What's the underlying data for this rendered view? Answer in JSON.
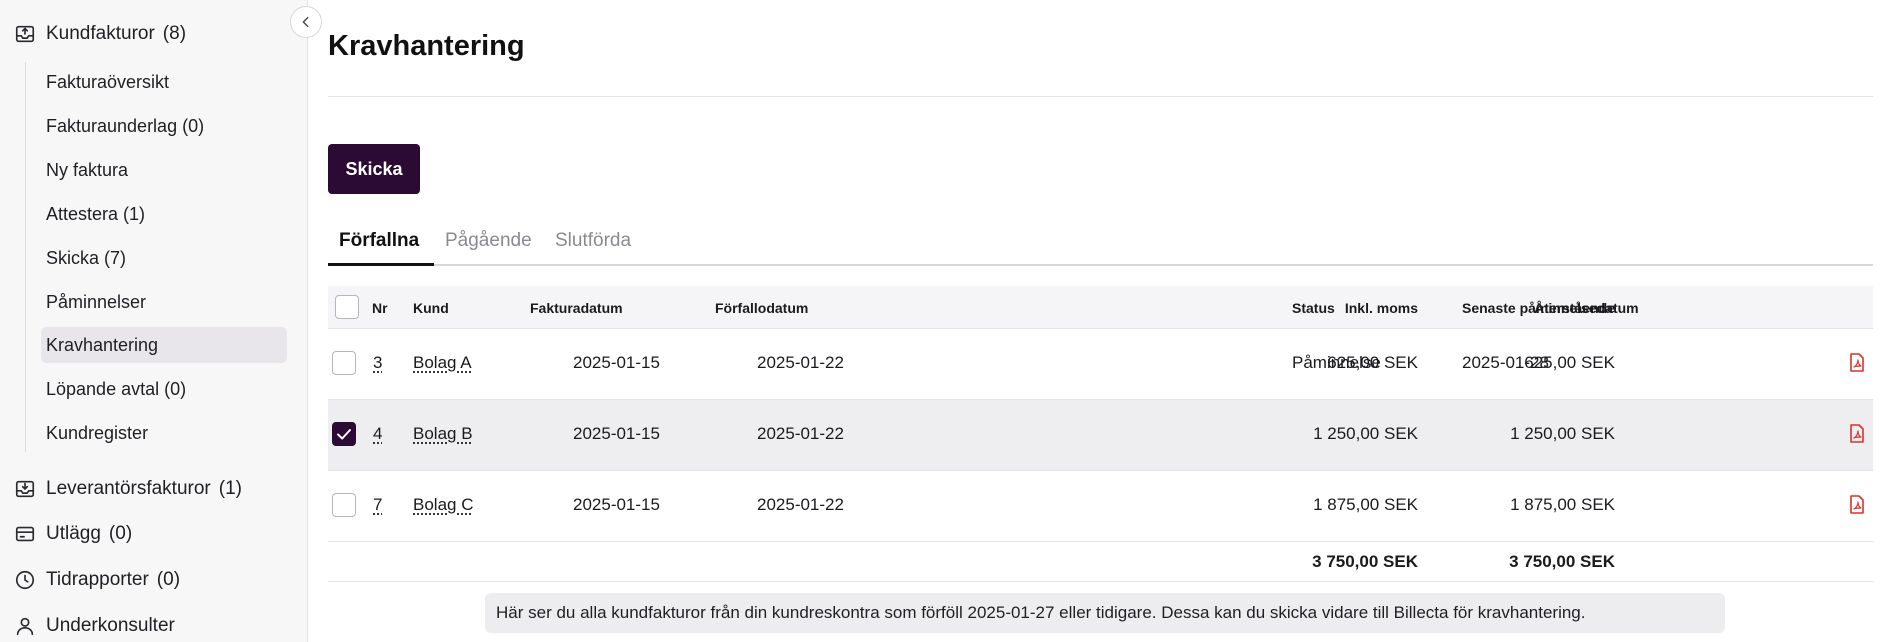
{
  "sidebar": {
    "groups": [
      {
        "label": "Kundfakturor",
        "count": "(8)",
        "icon": "invoice-out-icon"
      },
      {
        "label": "Leverantörsfakturor",
        "count": "(1)",
        "icon": "invoice-in-icon"
      },
      {
        "label": "Utlägg",
        "count": "(0)",
        "icon": "card-icon"
      },
      {
        "label": "Tidrapporter",
        "count": "(0)",
        "icon": "clock-icon"
      },
      {
        "label": "Underkonsulter",
        "count": "",
        "icon": "user-icon"
      }
    ],
    "items": [
      {
        "label": "Fakturaöversikt"
      },
      {
        "label": "Fakturaunderlag (0)"
      },
      {
        "label": "Ny faktura"
      },
      {
        "label": "Attestera (1)"
      },
      {
        "label": "Skicka (7)"
      },
      {
        "label": "Påminnelser"
      },
      {
        "label": "Kravhantering",
        "active": true
      },
      {
        "label": "Löpande avtal (0)"
      },
      {
        "label": "Kundregister"
      }
    ]
  },
  "page": {
    "title": "Kravhantering",
    "send_label": "Skicka",
    "tabs": [
      {
        "label": "Förfallna",
        "active": true
      },
      {
        "label": "Pågående"
      },
      {
        "label": "Slutförda"
      }
    ]
  },
  "table": {
    "headers": {
      "nr": "Nr",
      "kund": "Kund",
      "fakturadatum": "Fakturadatum",
      "forfallodatum": "Förfallodatum",
      "inkl_moms": "Inkl. moms",
      "aterstaende": "Återstående",
      "status": "Status",
      "senaste": "Senaste påminnelsedatum"
    },
    "rows": [
      {
        "nr": "3",
        "kund": "Bolag A",
        "fakturadatum": "2025-01-15",
        "forfallodatum": "2025-01-22",
        "inkl_moms": "625,00 SEK",
        "aterstaende": "625,00 SEK",
        "status": "Påminnelse",
        "senaste": "2025-01-28",
        "checked": false
      },
      {
        "nr": "4",
        "kund": "Bolag B",
        "fakturadatum": "2025-01-15",
        "forfallodatum": "2025-01-22",
        "inkl_moms": "1 250,00 SEK",
        "aterstaende": "1 250,00 SEK",
        "status": "",
        "senaste": "",
        "checked": true
      },
      {
        "nr": "7",
        "kund": "Bolag C",
        "fakturadatum": "2025-01-15",
        "forfallodatum": "2025-01-22",
        "inkl_moms": "1 875,00 SEK",
        "aterstaende": "1 875,00 SEK",
        "status": "",
        "senaste": "",
        "checked": false
      }
    ],
    "totals": {
      "inkl_moms": "3 750,00 SEK",
      "aterstaende": "3 750,00 SEK"
    }
  },
  "info_text": "Här ser du alla kundfakturor från din kundreskontra som förföll 2025-01-27 eller tidigare. Dessa kan du skicka vidare till Billecta för kravhantering.",
  "colors": {
    "accent": "#2b0a34",
    "pdf": "#d9342b",
    "selected_row": "#eeedf0"
  }
}
